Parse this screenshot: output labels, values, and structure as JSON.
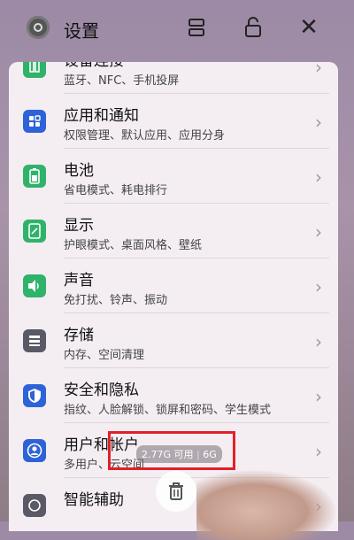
{
  "window": {
    "title": "设置",
    "icons": {
      "app": "settings-gear-icon",
      "split": "split-screen-icon",
      "lock": "lock-icon",
      "close": "close-icon"
    },
    "close_glyph": "✕"
  },
  "items": [
    {
      "title": "设备连接",
      "subtitle": "蓝牙、NFC、手机投屏",
      "icon": "device-connect-icon",
      "color": "#2fb36a"
    },
    {
      "title": "应用和通知",
      "subtitle": "权限管理、默认应用、应用分身",
      "icon": "apps-icon",
      "color": "#2d62d8"
    },
    {
      "title": "电池",
      "subtitle": "省电模式、耗电排行",
      "icon": "battery-icon",
      "color": "#2fb36a"
    },
    {
      "title": "显示",
      "subtitle": "护眼模式、桌面风格、壁纸",
      "icon": "display-icon",
      "color": "#2fb36a"
    },
    {
      "title": "声音",
      "subtitle": "免打扰、铃声、振动",
      "icon": "sound-icon",
      "color": "#2fb36a"
    },
    {
      "title": "存储",
      "subtitle": "内存、空间清理",
      "icon": "storage-icon",
      "color": "#5a5a66"
    },
    {
      "title": "安全和隐私",
      "subtitle": "指纹、人脸解锁、锁屏和密码、学生模式",
      "icon": "shield-icon",
      "color": "#2d62d8"
    },
    {
      "title": "用户和帐户",
      "subtitle": "多用户、云空间",
      "icon": "user-account-icon",
      "color": "#2d62d8"
    },
    {
      "title": "智能辅助",
      "subtitle": "",
      "icon": "smart-assist-icon",
      "color": "#5a5a66"
    }
  ],
  "chevron": "›",
  "memory": {
    "available": "2.77G 可用",
    "total": "6G"
  },
  "trash_icon": "trash-icon",
  "colors": {
    "highlight": "#e31f28"
  }
}
